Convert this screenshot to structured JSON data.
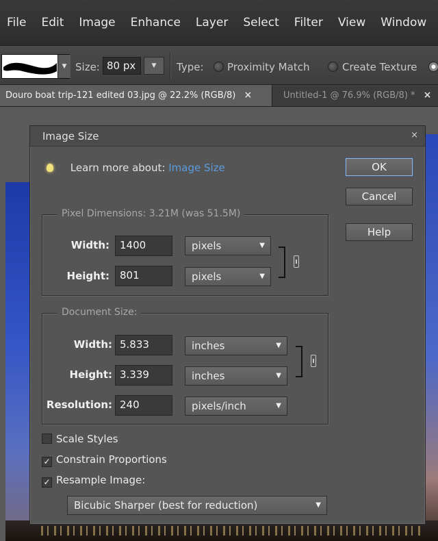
{
  "menu": [
    "File",
    "Edit",
    "Image",
    "Enhance",
    "Layer",
    "Select",
    "Filter",
    "View",
    "Window"
  ],
  "options_bar": {
    "size_label": "Size:",
    "size_value": "80 px",
    "type_label": "Type:",
    "radio_proximity": "Proximity Match",
    "radio_texture": "Create Texture"
  },
  "tabs": {
    "active": "Douro boat trip-121 edited 03.jpg @ 22.2% (RGB/8)",
    "inactive": "Untitled-1 @ 76.9% (RGB/8) *",
    "close_glyph": "×"
  },
  "dialog": {
    "title": "Image Size",
    "close_glyph": "×",
    "learn_more": "Learn more about:",
    "learn_link": "Image Size",
    "buttons": {
      "ok": "OK",
      "cancel": "Cancel",
      "help": "Help"
    },
    "pixel_dimensions": {
      "legend": "Pixel Dimensions:  3.21M (was 51.5M)",
      "width_label": "Width:",
      "width_value": "1400",
      "width_unit": "pixels",
      "height_label": "Height:",
      "height_value": "801",
      "height_unit": "pixels"
    },
    "document_size": {
      "legend": "Document Size:",
      "width_label": "Width:",
      "width_value": "5.833",
      "width_unit": "inches",
      "height_label": "Height:",
      "height_value": "3.339",
      "height_unit": "inches",
      "resolution_label": "Resolution:",
      "resolution_value": "240",
      "resolution_unit": "pixels/inch"
    },
    "checkboxes": {
      "scale_styles": {
        "label": "Scale Styles",
        "checked": false
      },
      "constrain": {
        "label": "Constrain Proportions",
        "checked": true
      },
      "resample": {
        "label": "Resample Image:",
        "checked": true
      }
    },
    "resample_method": "Bicubic Sharper (best for reduction)"
  },
  "colors": {
    "link": "#5a9bdc",
    "dialog_bg": "#555555",
    "menubar_bg": "#2f2f2f",
    "ok_focus": "#9bb6d6"
  },
  "icons": [
    "lightbulb-icon",
    "chain-link-icon",
    "dropdown-arrow-icon",
    "close-icon",
    "checkmark-icon"
  ]
}
